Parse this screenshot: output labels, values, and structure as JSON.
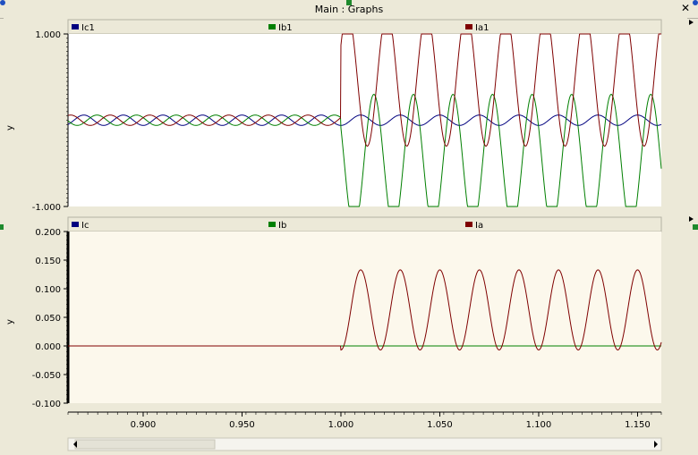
{
  "window": {
    "title": "Main : Graphs",
    "close_glyph": "✕"
  },
  "chart_data": [
    {
      "type": "line",
      "ylabel": "y",
      "ylim": [
        -1.0,
        1.0
      ],
      "y_tick_labels": [
        "1.000",
        "-1.000"
      ],
      "y_tick_values": [
        1.0,
        -1.0
      ],
      "x_range": [
        0.862,
        1.162
      ],
      "series": [
        {
          "name": "Ic1",
          "color": "#00007f",
          "pre_amplitude": 0.06,
          "post_amplitude": 0.06,
          "offset": 0.0,
          "phase_deg": -90
        },
        {
          "name": "Ib1",
          "color": "#007f00",
          "pre_amplitude": 0.06,
          "post_amplitude": 0.78,
          "offset": -0.48,
          "phase_deg": 150
        },
        {
          "name": "Ia1",
          "color": "#7f0000",
          "pre_amplitude": 0.06,
          "post_amplitude": 0.78,
          "offset": 0.48,
          "phase_deg": 30
        }
      ],
      "fault_time": 1.0,
      "frequency_hz": 50
    },
    {
      "type": "line",
      "ylabel": "y",
      "ylim": [
        -0.1,
        0.2
      ],
      "y_tick_labels": [
        "0.200",
        "0.150",
        "0.100",
        "0.050",
        "0.000",
        "-0.050",
        "-0.100"
      ],
      "y_tick_values": [
        0.2,
        0.15,
        0.1,
        0.05,
        0.0,
        -0.05,
        -0.1
      ],
      "x_range": [
        0.862,
        1.162
      ],
      "x_tick_labels": [
        "0.900",
        "0.950",
        "1.000",
        "1.050",
        "1.100",
        "1.150"
      ],
      "x_tick_values": [
        0.9,
        0.95,
        1.0,
        1.05,
        1.1,
        1.15
      ],
      "series": [
        {
          "name": "Ic",
          "color": "#00007f",
          "pre_amplitude": 0.0,
          "post_amplitude": 0.0,
          "offset": 0.0
        },
        {
          "name": "Ib",
          "color": "#007f00",
          "pre_amplitude": 0.0,
          "post_amplitude": 0.0,
          "offset": 0.0
        },
        {
          "name": "Ia",
          "color": "#7f0000",
          "pre_amplitude": 0.0,
          "post_amplitude": 0.07,
          "offset": 0.063,
          "phase_deg": 270
        }
      ],
      "fault_time": 1.0,
      "frequency_hz": 50
    }
  ],
  "colors": {
    "panel_top_bg": "#ffffff",
    "panel_bottom_bg": "#fcf8ec",
    "frame": "#ece9d8",
    "legend_bar": "#ece9d8"
  }
}
